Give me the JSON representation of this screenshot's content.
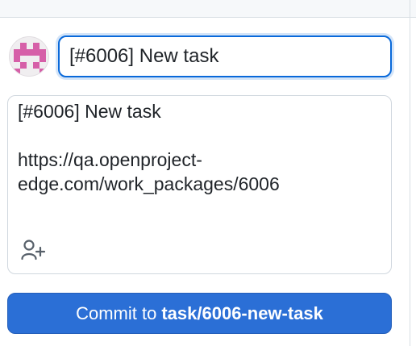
{
  "summary": {
    "value": "[#6006] New task"
  },
  "description": {
    "value": "[#6006] New task\n\nhttps://qa.openproject-\nedge.com/work_packages/6006"
  },
  "commit_button": {
    "prefix": "Commit to",
    "branch": "task/6006-new-task"
  },
  "icons": {
    "avatar": "identicon-avatar",
    "coauthor": "add-user-icon"
  },
  "colors": {
    "accent": "#2b6fd6",
    "focus_border": "#0969da",
    "identicon": "#d65fa8"
  }
}
